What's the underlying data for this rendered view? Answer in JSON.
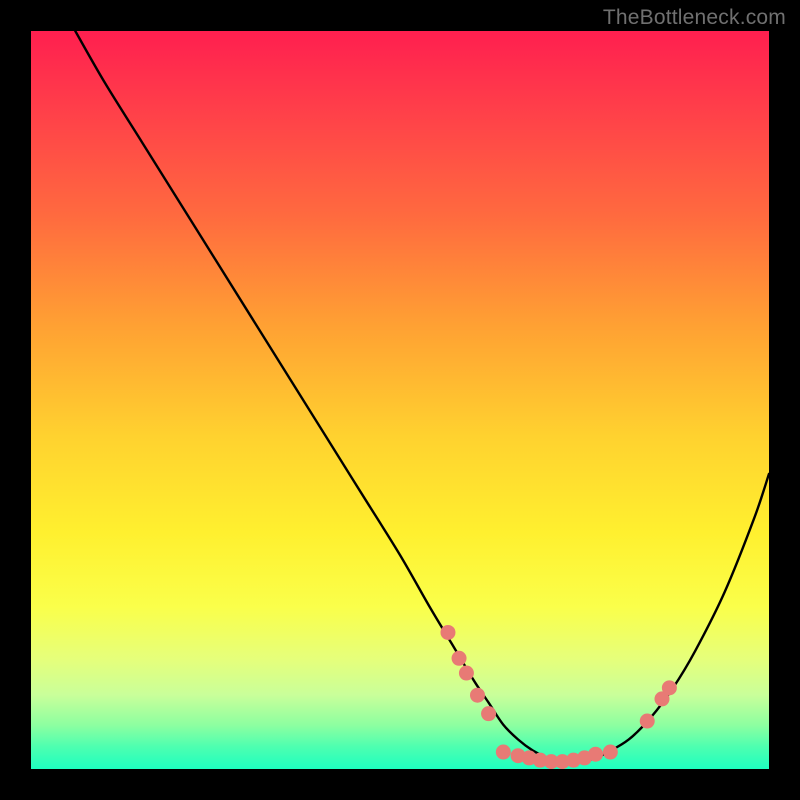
{
  "watermark": "TheBottleneck.com",
  "chart_data": {
    "type": "line",
    "title": "",
    "xlabel": "",
    "ylabel": "",
    "xlim": [
      0,
      100
    ],
    "ylim": [
      0,
      100
    ],
    "series": [
      {
        "name": "curve",
        "x": [
          6,
          10,
          15,
          20,
          25,
          30,
          35,
          40,
          45,
          50,
          54,
          57,
          60,
          62,
          64,
          66,
          68,
          70,
          72,
          74,
          76,
          78,
          81,
          84,
          87,
          90,
          94,
          98,
          100
        ],
        "y": [
          100,
          93,
          85,
          77,
          69,
          61,
          53,
          45,
          37,
          29,
          22,
          17,
          12,
          9,
          6,
          4,
          2.5,
          1.5,
          1,
          1,
          1.3,
          2.2,
          4,
          7,
          11,
          16,
          24,
          34,
          40
        ]
      }
    ],
    "points": [
      {
        "x": 56.5,
        "y": 18.5
      },
      {
        "x": 58.0,
        "y": 15.0
      },
      {
        "x": 59.0,
        "y": 13.0
      },
      {
        "x": 60.5,
        "y": 10.0
      },
      {
        "x": 62.0,
        "y": 7.5
      },
      {
        "x": 64.0,
        "y": 2.3
      },
      {
        "x": 66.0,
        "y": 1.8
      },
      {
        "x": 67.5,
        "y": 1.5
      },
      {
        "x": 69.0,
        "y": 1.2
      },
      {
        "x": 70.5,
        "y": 1.0
      },
      {
        "x": 72.0,
        "y": 1.0
      },
      {
        "x": 73.5,
        "y": 1.2
      },
      {
        "x": 75.0,
        "y": 1.5
      },
      {
        "x": 76.5,
        "y": 2.0
      },
      {
        "x": 78.5,
        "y": 2.3
      },
      {
        "x": 83.5,
        "y": 6.5
      },
      {
        "x": 85.5,
        "y": 9.5
      },
      {
        "x": 86.5,
        "y": 11.0
      }
    ]
  }
}
